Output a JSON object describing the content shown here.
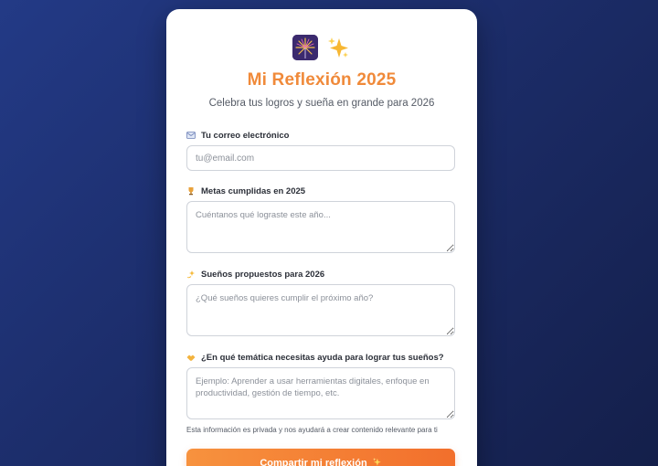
{
  "header": {
    "icons": [
      "firework-icon",
      "sparkles-icon"
    ],
    "title": "Mi Reflexión 2025",
    "subtitle": "Celebra tus logros y sueña en grande para 2026"
  },
  "form": {
    "email": {
      "icon": "email-icon",
      "label": "Tu correo electrónico",
      "placeholder": "tu@email.com",
      "value": ""
    },
    "goals": {
      "icon": "trophy-icon",
      "label": "Metas cumplidas en 2025",
      "placeholder": "Cuéntanos qué lograste este año...",
      "value": ""
    },
    "dreams": {
      "icon": "dizzy-star-icon",
      "label": "Sueños propuestos para 2026",
      "placeholder": "¿Qué sueños quieres cumplir el próximo año?",
      "value": ""
    },
    "help": {
      "icon": "handshake-icon",
      "label": "¿En qué temática necesitas ayuda para lograr tus sueños?",
      "placeholder": "Ejemplo: Aprender a usar herramientas digitales, enfoque en productividad, gestión de tiempo, etc.",
      "value": ""
    },
    "hint": "Esta información es privada y nos ayudará a crear contenido relevante para ti",
    "submit_label": "Compartir mi reflexión",
    "submit_icon": "sparkles-icon"
  },
  "colors": {
    "accent": "#f08a3a",
    "button_start": "#f7923e",
    "button_end": "#f26f2c",
    "background": "#1c2d6a"
  }
}
